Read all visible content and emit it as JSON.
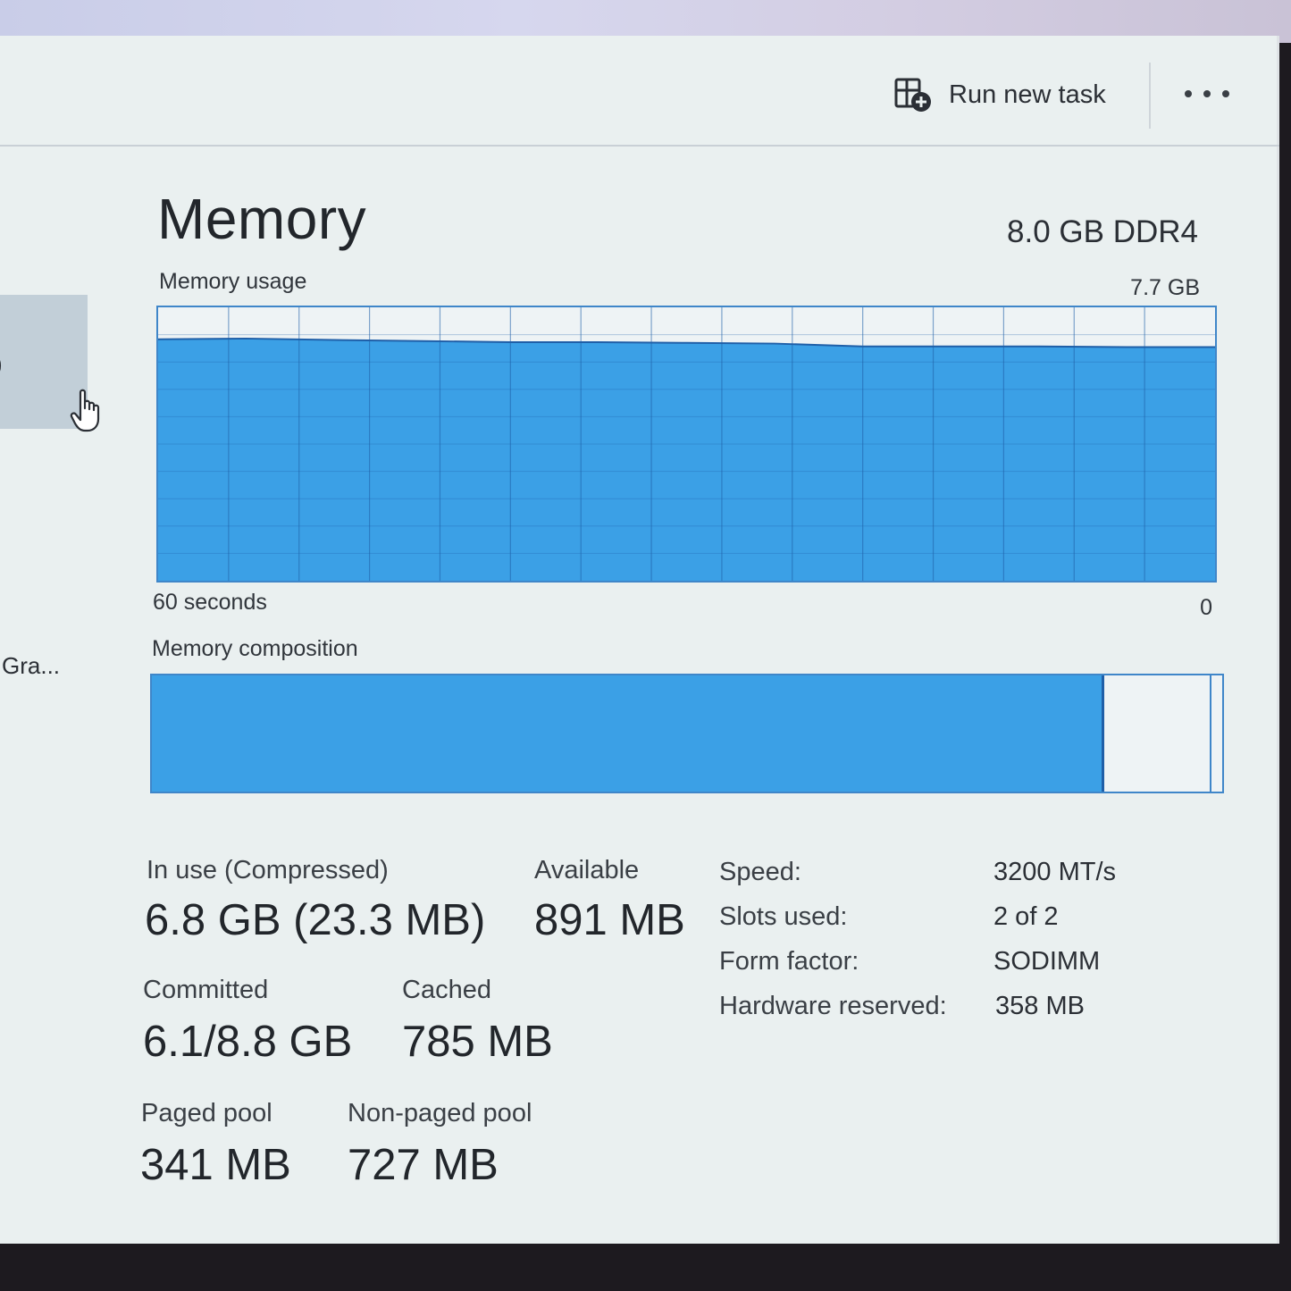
{
  "toolbar": {
    "run_new_task_label": "Run new task"
  },
  "sidebar": {
    "partial_item_label": "Gra...",
    "selected_partial_glyph": ")"
  },
  "header": {
    "title": "Memory",
    "spec": "8.0 GB DDR4"
  },
  "usage_chart": {
    "label": "Memory usage",
    "max_label": "7.7 GB",
    "time_label": "60 seconds",
    "min_label": "0",
    "fill_color": "#3ba0e6",
    "line_color": "#1f5fa8",
    "grid_color": "#1f5fa8"
  },
  "composition": {
    "label": "Memory composition",
    "in_use_fraction": 0.89,
    "standby_fraction": 0.1
  },
  "stats": {
    "in_use": {
      "label": "In use (Compressed)",
      "value": "6.8 GB (23.3 MB)"
    },
    "available": {
      "label": "Available",
      "value": "891 MB"
    },
    "committed": {
      "label": "Committed",
      "value": "6.1/8.8 GB"
    },
    "cached": {
      "label": "Cached",
      "value": "785 MB"
    },
    "paged_pool": {
      "label": "Paged pool",
      "value": "341 MB"
    },
    "non_paged_pool": {
      "label": "Non-paged pool",
      "value": "727 MB"
    }
  },
  "details": [
    {
      "key": "Speed:",
      "value": "3200 MT/s"
    },
    {
      "key": "Slots used:",
      "value": "2 of 2"
    },
    {
      "key": "Form factor:",
      "value": "SODIMM"
    },
    {
      "key": "Hardware reserved:",
      "value": "358 MB"
    }
  ],
  "chart_data": {
    "type": "area",
    "title": "Memory usage",
    "x": [
      60,
      55,
      50,
      45,
      40,
      35,
      30,
      25,
      20,
      15,
      10,
      5,
      0
    ],
    "series": [
      {
        "values": [
          6.8,
          6.82,
          6.78,
          6.75,
          6.72,
          6.72,
          6.7,
          6.68,
          6.6,
          6.6,
          6.6,
          6.58,
          6.58
        ]
      }
    ],
    "xlabel": "60 seconds",
    "ylim": [
      0,
      7.7
    ],
    "xlim": [
      60,
      0
    ]
  }
}
